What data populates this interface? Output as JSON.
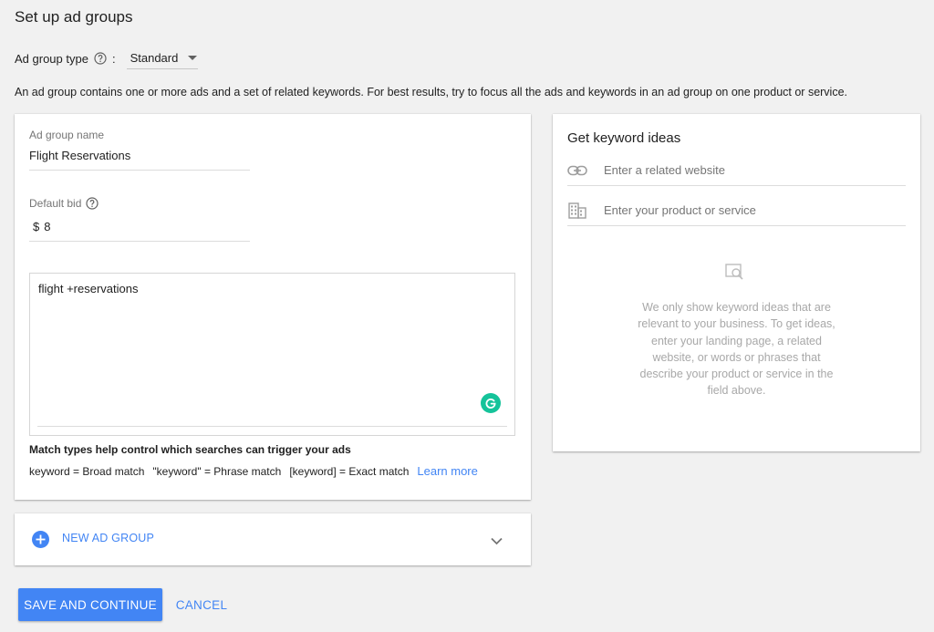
{
  "page": {
    "title": "Set up ad groups",
    "description": "An ad group contains one or more ads and a set of related keywords. For best results, try to focus all the ads and keywords in an ad group on one product or service."
  },
  "ad_group_type": {
    "label": "Ad group type",
    "colon": ":",
    "selected": "Standard"
  },
  "ad_group": {
    "name_label": "Ad group name",
    "name_value": "Flight Reservations",
    "bid_label": "Default bid",
    "bid_currency": "$",
    "bid_value": "8",
    "keywords_value": "flight +reservations",
    "match_title": "Match types help control which searches can trigger your ads",
    "match_broad": "keyword = Broad match",
    "match_phrase": "\"keyword\" = Phrase match",
    "match_exact": "[keyword] = Exact match",
    "learn_more": "Learn more"
  },
  "keyword_ideas": {
    "title": "Get keyword ideas",
    "website_placeholder": "Enter a related website",
    "product_placeholder": "Enter your product or service",
    "empty_text": "We only show keyword ideas that are relevant to your business. To get ideas, enter your landing page, a related website, or words or phrases that describe your product or service in the field above."
  },
  "new_ad_group": {
    "label": "NEW AD GROUP"
  },
  "actions": {
    "save_label": "SAVE AND CONTINUE",
    "cancel_label": "CANCEL"
  },
  "icons": {
    "help": "help-circle-icon",
    "dropdown": "caret-down-icon",
    "link": "link-icon",
    "business": "building-icon",
    "search": "search-document-icon",
    "add": "plus-circle-icon",
    "expand": "chevron-down-icon",
    "grammarly": "grammarly-icon"
  },
  "colors": {
    "accent": "#4285f4",
    "grammarly": "#15c39a",
    "background": "#f1f1f1"
  }
}
